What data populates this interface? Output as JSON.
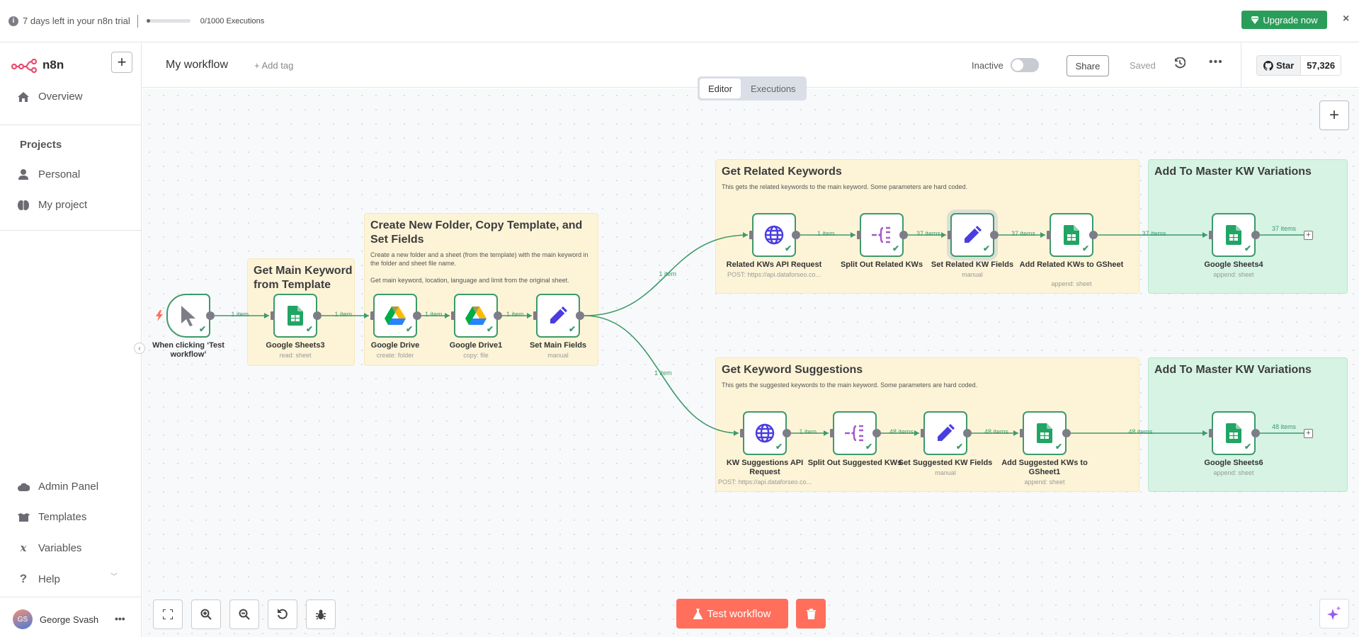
{
  "banner": {
    "trial_text": "7 days left in your n8n trial",
    "executions_text": "0/1000 Executions",
    "executions_progress": 0.0,
    "upgrade_label": "Upgrade now",
    "close_icon": "×"
  },
  "sidebar": {
    "brand": "n8n",
    "new_icon": "+",
    "overview": "Overview",
    "projects_title": "Projects",
    "projects": [
      {
        "label": "Personal",
        "icon": "user-icon"
      },
      {
        "label": "My project",
        "icon": "brain-icon"
      }
    ],
    "bottom_items": [
      {
        "label": "Admin Panel",
        "icon": "cloud-icon"
      },
      {
        "label": "Templates",
        "icon": "box-open-icon"
      },
      {
        "label": "Variables",
        "icon": "variable-icon"
      },
      {
        "label": "Help",
        "icon": "question-icon"
      }
    ],
    "user": {
      "initials": "GS",
      "name": "George Svash",
      "menu": "•••"
    }
  },
  "header": {
    "workflow_name": "My workflow",
    "add_tag": "+ Add tag",
    "status_label": "Inactive",
    "active": false,
    "share": "Share",
    "saved": "Saved",
    "more": "•••",
    "github": {
      "star": "Star",
      "count": "57,326"
    }
  },
  "tabs": [
    {
      "label": "Editor",
      "active": true
    },
    {
      "label": "Executions",
      "active": false
    }
  ],
  "stickies": [
    {
      "title": "Get Main Keyword from Template",
      "body": []
    },
    {
      "title": "Create New Folder, Copy Template, and Set Fields",
      "body": [
        "Create a new folder and a sheet (from the template) with the main keyword in the folder and sheet file name.",
        "Get main keyword, location, language and limit from the original sheet."
      ]
    },
    {
      "title": "Get Related Keywords",
      "body": [
        "This gets the related keywords to the main keyword. Some parameters are hard coded."
      ]
    },
    {
      "title": "Add To Master KW Variations",
      "body": []
    },
    {
      "title": "Get Keyword Suggestions",
      "body": [
        "This gets the suggested keywords to the main keyword. Some parameters are hard coded."
      ]
    },
    {
      "title": "Add To Master KW Variations",
      "body": []
    }
  ],
  "nodes": [
    {
      "name": "When clicking ‘Test workflow’",
      "sub": "",
      "icon": "cursor-icon"
    },
    {
      "name": "Google Sheets3",
      "sub": "read: sheet",
      "icon": "google-sheets-icon"
    },
    {
      "name": "Google Drive",
      "sub": "create: folder",
      "icon": "google-drive-icon"
    },
    {
      "name": "Google Drive1",
      "sub": "copy: file",
      "icon": "google-drive-icon"
    },
    {
      "name": "Set Main Fields",
      "sub": "manual",
      "icon": "pencil-icon"
    },
    {
      "name": "Related KWs API Request",
      "sub": "POST: https://api.dataforseo.co...",
      "icon": "globe-icon"
    },
    {
      "name": "Split Out Related KWs",
      "sub": "",
      "icon": "split-out-icon"
    },
    {
      "name": "Set Related KW Fields",
      "sub": "manual",
      "icon": "pencil-icon"
    },
    {
      "name": "Add Related KWs to GSheet",
      "sub": "append: sheet",
      "icon": "google-sheets-icon"
    },
    {
      "name": "Google Sheets4",
      "sub": "append: sheet",
      "icon": "google-sheets-icon"
    },
    {
      "name": "KW Suggestions API Request",
      "sub": "POST: https://api.dataforseo.co...",
      "icon": "globe-icon"
    },
    {
      "name": "Split Out Suggested KWs",
      "sub": "",
      "icon": "split-out-icon"
    },
    {
      "name": "Set Suggested KW Fields",
      "sub": "manual",
      "icon": "pencil-icon"
    },
    {
      "name": "Add Suggested KWs to GSheet1",
      "sub": "append: sheet",
      "icon": "google-sheets-icon"
    },
    {
      "name": "Google Sheets6",
      "sub": "append: sheet",
      "icon": "google-sheets-icon"
    }
  ],
  "edges": [
    {
      "label": "1 item"
    },
    {
      "label": "1 item"
    },
    {
      "label": "1 item"
    },
    {
      "label": "1 item"
    },
    {
      "label": "1 item"
    },
    {
      "label": "1 item"
    },
    {
      "label": "1 item"
    },
    {
      "label": "37 items"
    },
    {
      "label": "37 items"
    },
    {
      "label": "37 items"
    },
    {
      "label": "37 items"
    },
    {
      "label": "1 item"
    },
    {
      "label": "48 items"
    },
    {
      "label": "48 items"
    },
    {
      "label": "48 items"
    },
    {
      "label": "48 items"
    }
  ],
  "canvas": {
    "test_workflow": "Test workflow",
    "add_node_icon": "+"
  },
  "colors": {
    "accent": "#ff6f5c",
    "success": "#3d9a6a",
    "upgrade": "#2a9d5a",
    "sticky_yellow": "#fdf4d7",
    "sticky_green": "#d6f3e4"
  }
}
